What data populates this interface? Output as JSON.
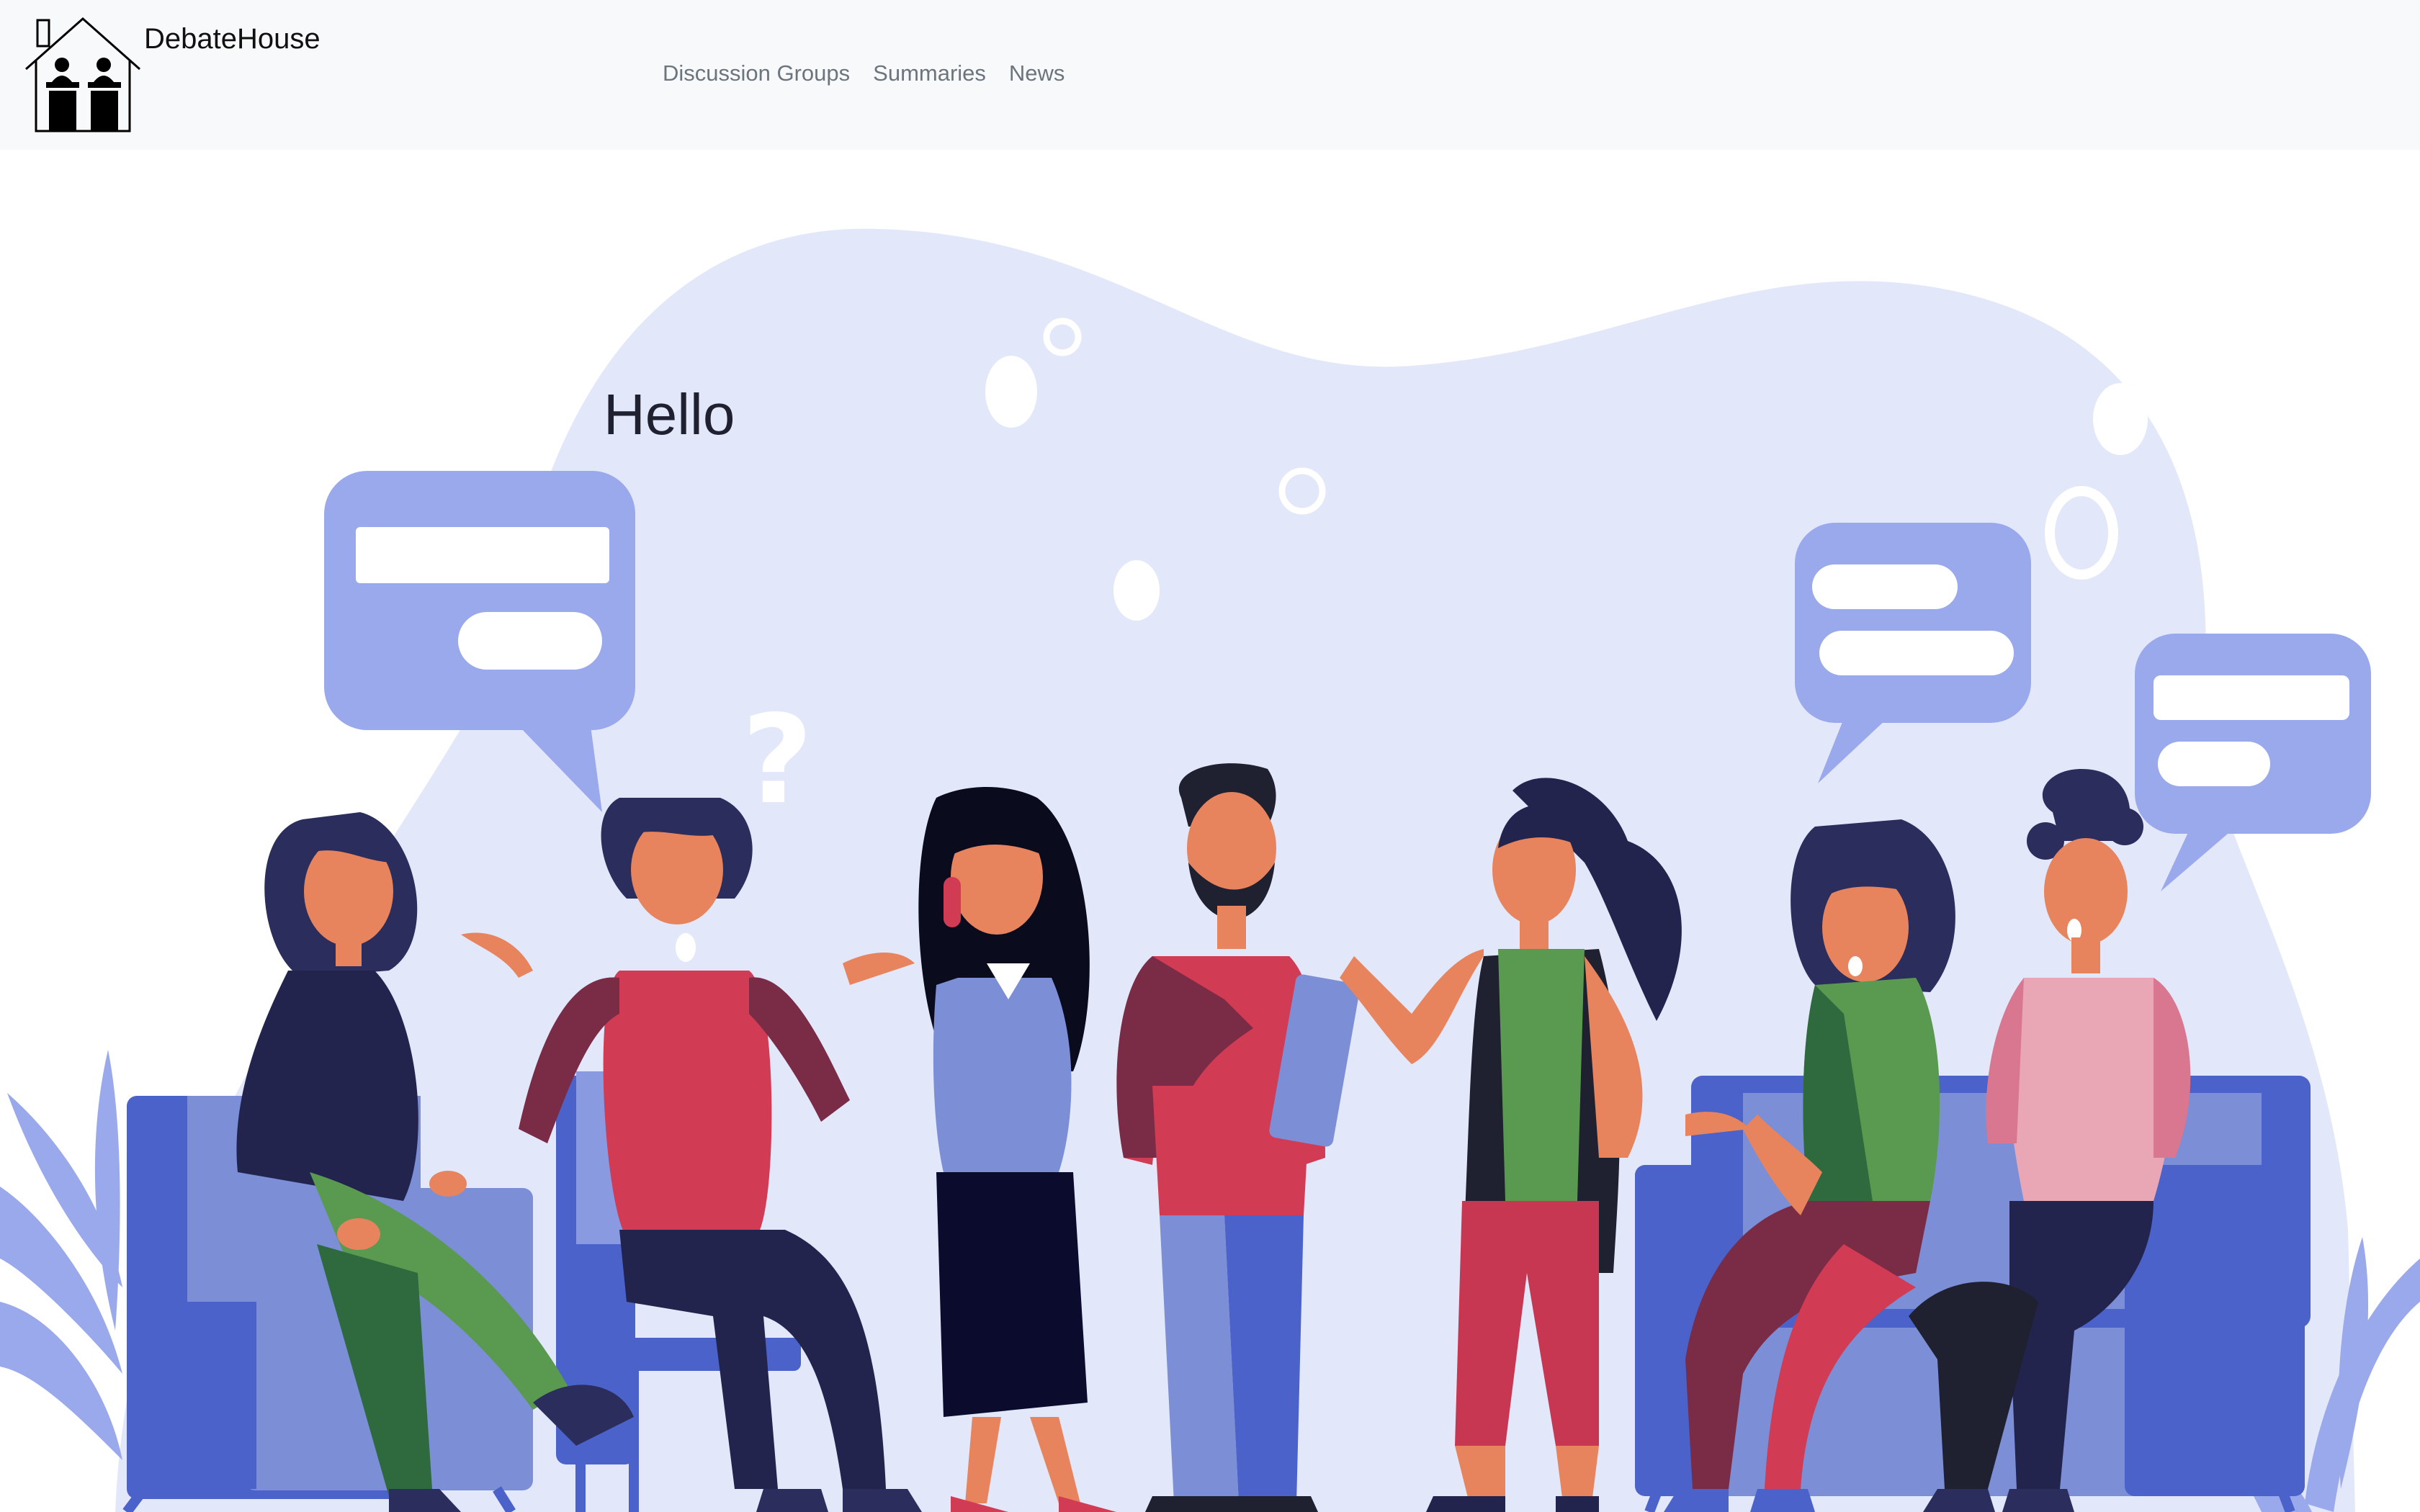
{
  "navbar": {
    "brand_name": "DebateHouse",
    "links": [
      {
        "label": "Discussion Groups"
      },
      {
        "label": "Summaries"
      },
      {
        "label": "News"
      }
    ]
  },
  "hero": {
    "greeting": "Hello",
    "illustration": "people-discussion-illustration"
  },
  "colors": {
    "navbar_bg": "#f8f9fa",
    "nav_link": "#6c757d",
    "blob": "#e3e7fa",
    "bubble": "#9aa9ec",
    "chair": "#4a62c9",
    "text_dark": "#1f2030"
  }
}
